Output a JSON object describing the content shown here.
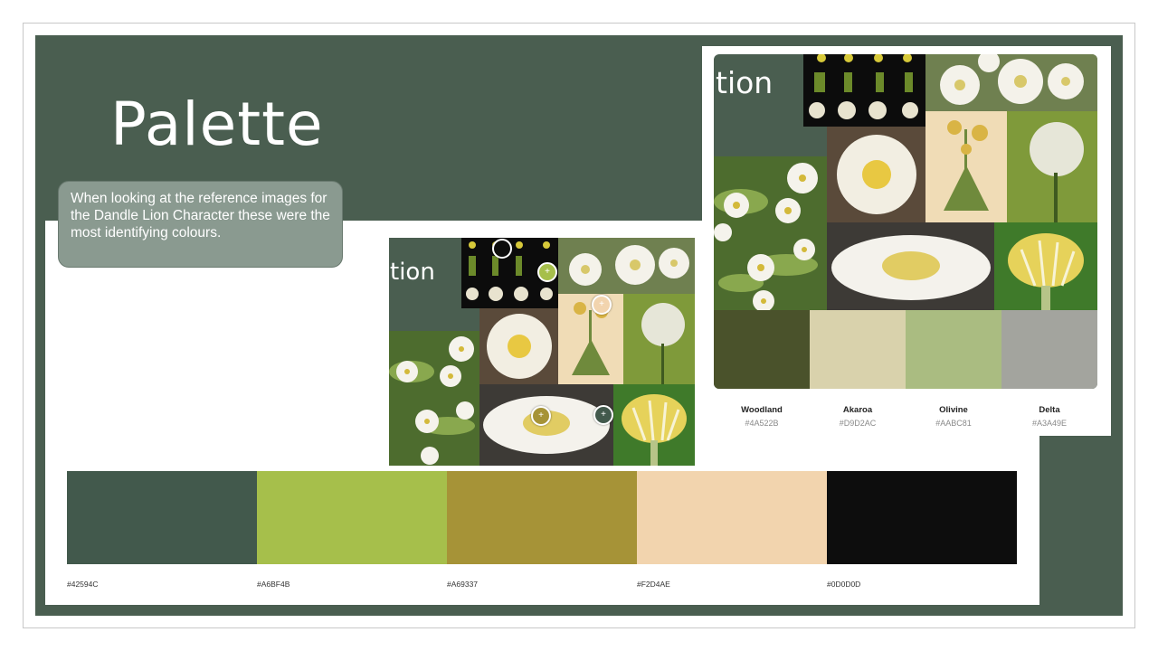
{
  "slide": {
    "title": "Palette",
    "description": "When looking at the reference images for the Dandle Lion Character these were the most identifying colours."
  },
  "collage_small": {
    "fragment_text": "tion"
  },
  "collage_large": {
    "fragment_text": "tion",
    "swatches": [
      {
        "name": "Woodland",
        "hex": "#4A522B",
        "color": "#4a522b"
      },
      {
        "name": "Akaroa",
        "hex": "#D9D2AC",
        "color": "#d9d2ac"
      },
      {
        "name": "Olivine",
        "hex": "#AABC81",
        "color": "#aabc81"
      },
      {
        "name": "Delta",
        "hex": "#A3A49E",
        "color": "#a3a49e"
      }
    ]
  },
  "palette_bar": [
    {
      "hex": "#42594C",
      "color": "#42594c"
    },
    {
      "hex": "#A6BF4B",
      "color": "#a6bf4b"
    },
    {
      "hex": "#A69337",
      "color": "#a69337"
    },
    {
      "hex": "#F2D4AE",
      "color": "#f2d4ae"
    },
    {
      "hex": "#0D0D0D",
      "color": "#0d0d0d"
    }
  ],
  "picker_colors": [
    "#0d0d0d",
    "#a6bf4b",
    "#f2d4ae",
    "#a69337",
    "#42594c"
  ]
}
